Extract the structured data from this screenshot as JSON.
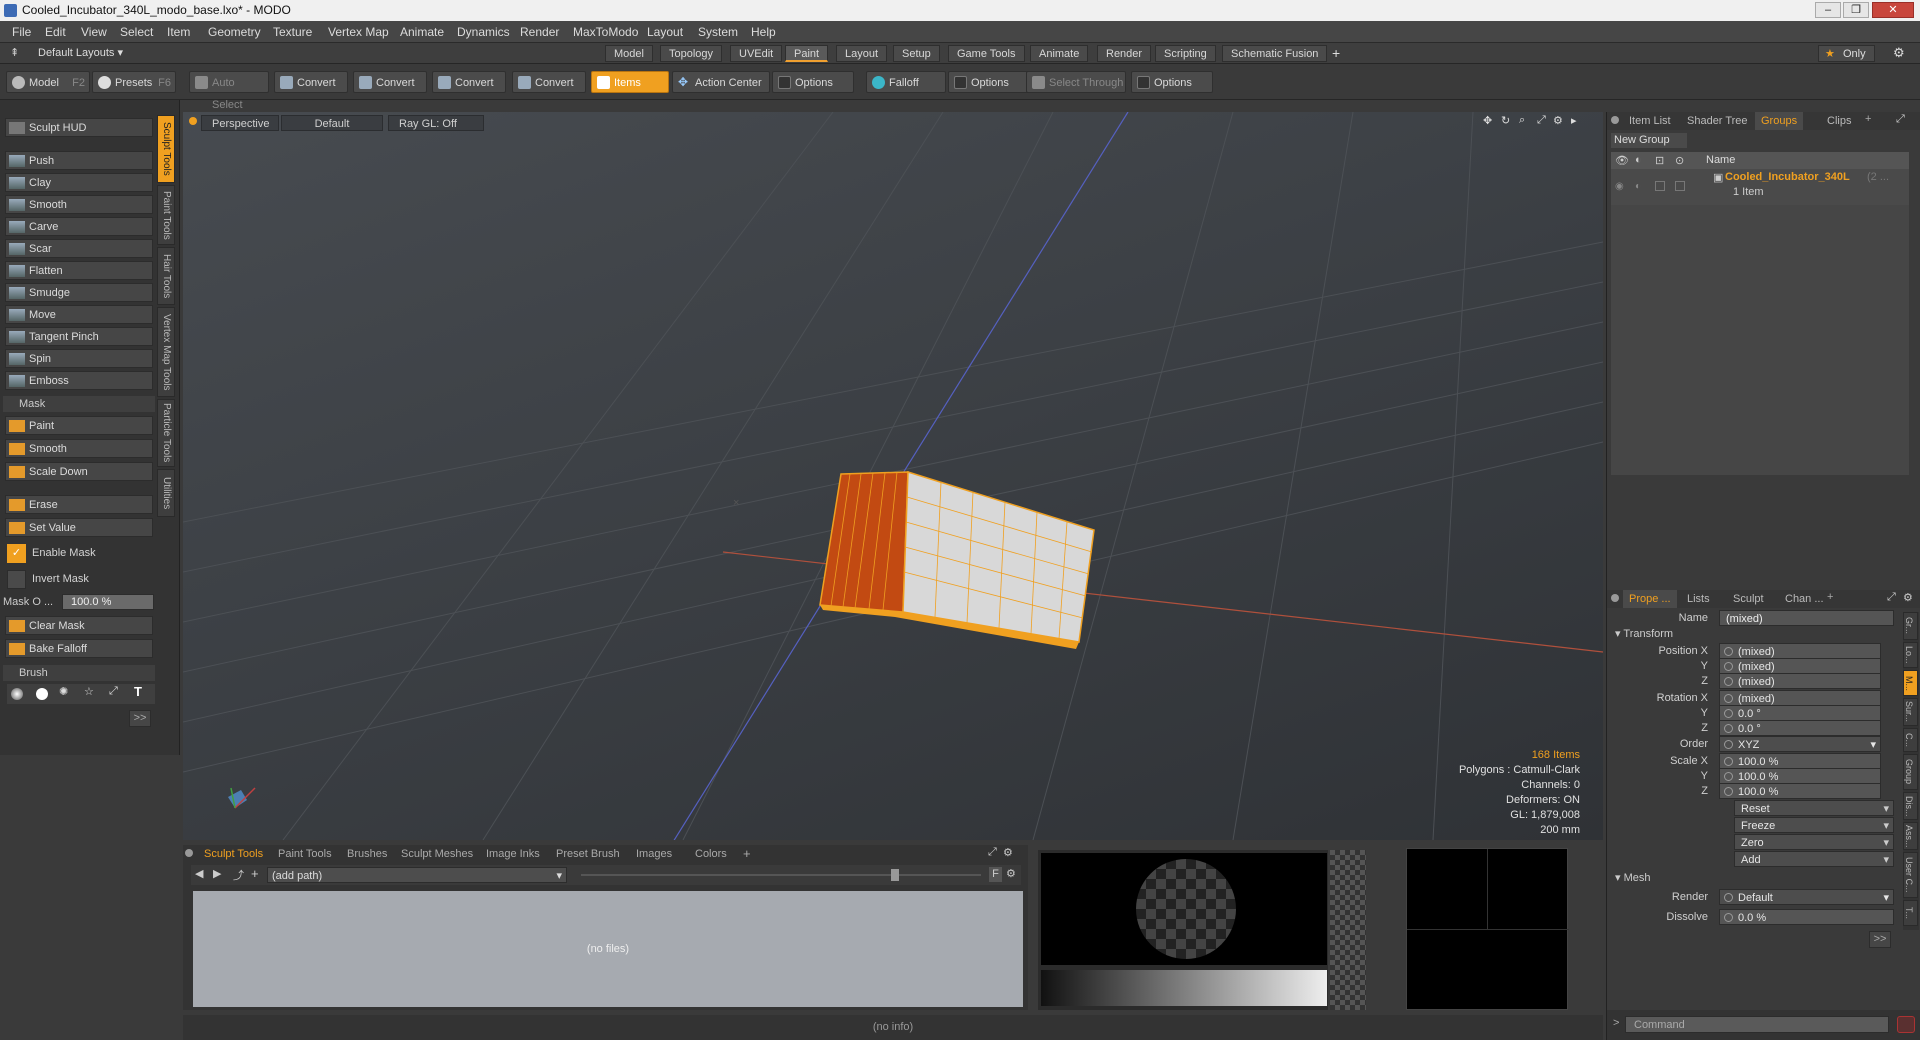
{
  "window": {
    "title": "Cooled_Incubator_340L_modo_base.lxo* - MODO"
  },
  "menu": [
    "File",
    "Edit",
    "View",
    "Select",
    "Item",
    "Geometry",
    "Texture",
    "Vertex Map",
    "Animate",
    "Dynamics",
    "Render",
    "MaxToModo",
    "Layout",
    "System",
    "Help"
  ],
  "layoutbar": {
    "layouts_label": "Default Layouts",
    "tabs": [
      "Model",
      "Topology",
      "UVEdit",
      "Paint",
      "Layout",
      "Setup",
      "Game Tools",
      "Animate",
      "Render",
      "Scripting",
      "Schematic Fusion"
    ],
    "active_tab": "Paint",
    "only_label": "Only"
  },
  "toolbar": {
    "model": "Model",
    "model_key": "F2",
    "presets": "Presets",
    "presets_key": "F6",
    "auto_select": "Auto Select",
    "convert": "Convert",
    "items": "Items",
    "action_center": "Action Center",
    "options": "Options",
    "falloff": "Falloff",
    "select_through": "Select Through"
  },
  "left": {
    "hud": "Sculpt HUD",
    "tools": [
      "Push",
      "Clay",
      "Smooth",
      "Carve",
      "Scar",
      "Flatten",
      "Smudge",
      "Move",
      "Tangent Pinch",
      "Spin",
      "Emboss"
    ],
    "mask_section": "Mask",
    "mask_tools": [
      "Paint",
      "Smooth",
      "Scale Down"
    ],
    "erase": "Erase",
    "set_value": "Set Value",
    "enable_mask": "Enable Mask",
    "invert_mask": "Invert Mask",
    "mask_opacity_label": "Mask O ...",
    "mask_opacity_value": "100.0 %",
    "clear_mask": "Clear Mask",
    "bake_falloff": "Bake Falloff",
    "brush_section": "Brush",
    "more": ">>"
  },
  "vtabs": [
    "Sculpt Tools",
    "Paint Tools",
    "Hair Tools",
    "Vertex Map Tools",
    "Particle Tools",
    "Utilities"
  ],
  "viewport": {
    "view": "Perspective",
    "style": "Default",
    "raygl": "Ray GL: Off",
    "stats": {
      "items": "168 Items",
      "polygons": "Polygons : Catmull-Clark",
      "channels": "Channels: 0",
      "deformers": "Deformers: ON",
      "gl": "GL: 1,879,008",
      "scale": "200 mm"
    }
  },
  "bottom": {
    "tabs": [
      "Sculpt Tools",
      "Paint Tools",
      "Brushes",
      "Sculpt Meshes",
      "Image Inks",
      "Preset Brush",
      "Images",
      "Colors"
    ],
    "path": "(add path)",
    "nofiles": "(no files)",
    "f_label": "F"
  },
  "right": {
    "top_tabs": [
      "Item List",
      "Shader Tree",
      "Groups",
      "Clips"
    ],
    "new_group": "New Group",
    "name_col": "Name",
    "group_name": "Cooled_Incubator_340L",
    "group_suffix": "(2 ...",
    "group_count": "1 Item",
    "prop_tabs": [
      "Prope ...",
      "Lists",
      "Sculpt",
      "Chan ..."
    ],
    "name_label": "Name",
    "name_value": "(mixed)",
    "transform": "Transform",
    "pos_label": "Position X",
    "rot_label": "Rotation X",
    "order_label": "Order",
    "scale_label": "Scale X",
    "y": "Y",
    "z": "Z",
    "mixed": "(mixed)",
    "deg0": "0.0 °",
    "order": "XYZ",
    "pct100": "100.0 %",
    "reset": "Reset",
    "freeze": "Freeze",
    "zero": "Zero",
    "add": "Add",
    "mesh": "Mesh",
    "render_label": "Render",
    "render_value": "Default",
    "dissolve_label": "Dissolve",
    "dissolve_value": "0.0 %",
    "more": ">>",
    "command": "Command",
    "side_tabs": [
      "Gr...",
      "Lo...",
      "M...",
      "Sur...",
      "C...",
      "Group",
      "Dis...",
      "Ass...",
      "User C...",
      "T..."
    ]
  },
  "status": "(no info)"
}
